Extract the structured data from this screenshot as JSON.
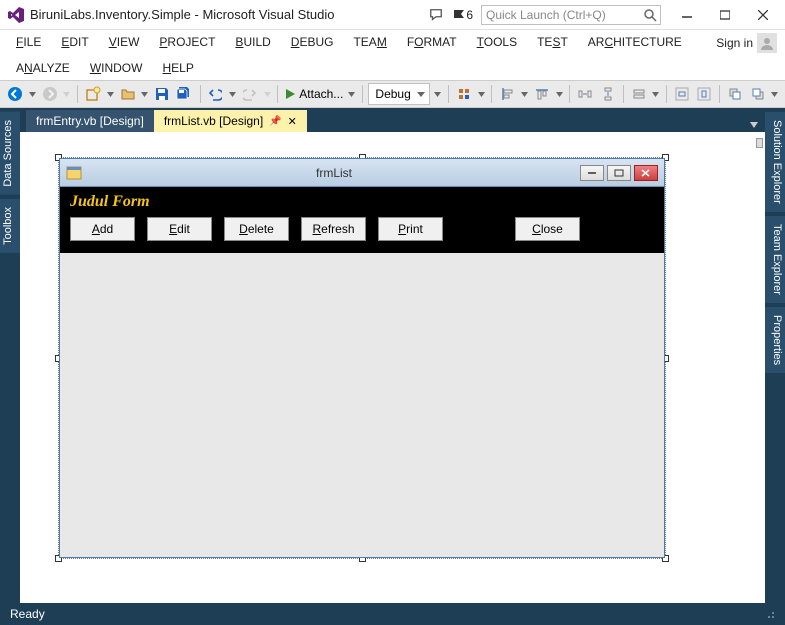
{
  "titlebar": {
    "title": "BiruniLabs.Inventory.Simple - Microsoft Visual Studio",
    "notification_count": "6",
    "quick_launch_placeholder": "Quick Launch (Ctrl+Q)",
    "signin": "Sign in"
  },
  "menu": {
    "row1": [
      {
        "pre": "",
        "u": "F",
        "post": "ILE"
      },
      {
        "pre": "",
        "u": "E",
        "post": "DIT"
      },
      {
        "pre": "",
        "u": "V",
        "post": "IEW"
      },
      {
        "pre": "",
        "u": "P",
        "post": "ROJECT"
      },
      {
        "pre": "",
        "u": "B",
        "post": "UILD"
      },
      {
        "pre": "",
        "u": "D",
        "post": "EBUG"
      },
      {
        "pre": "TEA",
        "u": "M",
        "post": ""
      },
      {
        "pre": "F",
        "u": "O",
        "post": "RMAT"
      },
      {
        "pre": "",
        "u": "T",
        "post": "OOLS"
      },
      {
        "pre": "TE",
        "u": "S",
        "post": "T"
      },
      {
        "pre": "AR",
        "u": "C",
        "post": "HITECTURE"
      }
    ],
    "row2": [
      {
        "pre": "A",
        "u": "N",
        "post": "ALYZE"
      },
      {
        "pre": "",
        "u": "W",
        "post": "INDOW"
      },
      {
        "pre": "",
        "u": "H",
        "post": "ELP"
      }
    ]
  },
  "toolbar": {
    "attach": "Attach...",
    "config": "Debug"
  },
  "left_panels": {
    "data_sources": "Data Sources",
    "toolbox": "Toolbox"
  },
  "right_panels": {
    "solution_explorer": "Solution Explorer",
    "team_explorer": "Team Explorer",
    "properties": "Properties"
  },
  "tabs": {
    "inactive": "frmEntry.vb [Design]",
    "active": "frmList.vb [Design]"
  },
  "form": {
    "title": "frmList",
    "header_label": "Judul Form",
    "buttons": {
      "add": {
        "pre": "",
        "u": "A",
        "post": "dd"
      },
      "edit": {
        "pre": "",
        "u": "E",
        "post": "dit"
      },
      "delete": {
        "pre": "",
        "u": "D",
        "post": "elete"
      },
      "refresh": {
        "pre": "",
        "u": "R",
        "post": "efresh"
      },
      "print": {
        "pre": "",
        "u": "P",
        "post": "rint"
      },
      "close": {
        "pre": "",
        "u": "C",
        "post": "lose"
      }
    }
  },
  "statusbar": {
    "text": "Ready"
  }
}
